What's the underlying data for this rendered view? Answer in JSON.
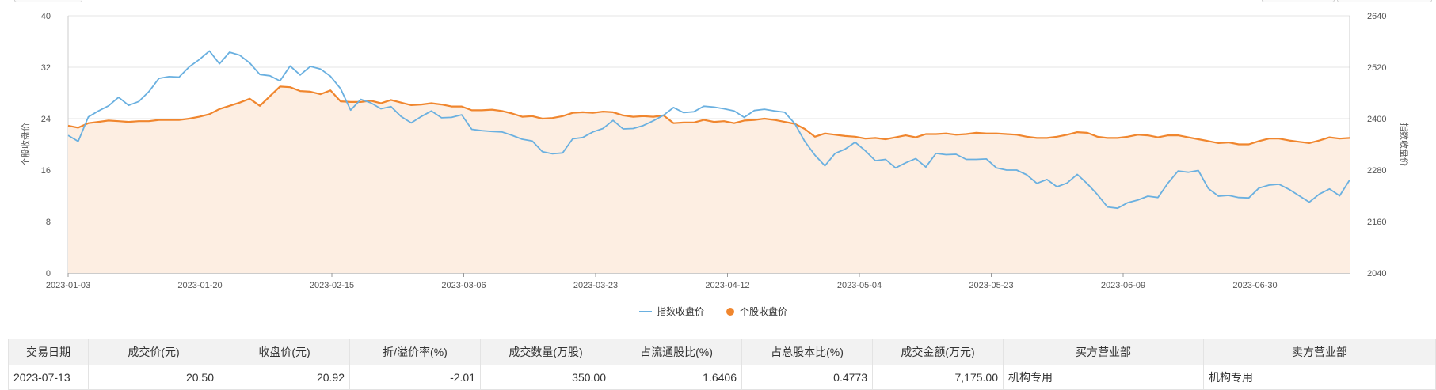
{
  "chart_data": {
    "type": "line",
    "x_ticks": [
      "2023-01-03",
      "2023-01-20",
      "2023-02-15",
      "2023-03-06",
      "2023-03-23",
      "2023-04-12",
      "2023-05-04",
      "2023-05-23",
      "2023-06-09",
      "2023-06-30"
    ],
    "left_axis": {
      "label": "个股收盘价",
      "ticks": [
        0,
        8,
        16,
        24,
        32,
        40
      ],
      "range": [
        0,
        40
      ]
    },
    "right_axis": {
      "label": "指数收盘价",
      "ticks": [
        2040,
        2160,
        2280,
        2400,
        2520,
        2640
      ],
      "range": [
        2040,
        2640
      ]
    },
    "legend": [
      "指数收盘价",
      "个股收盘价"
    ],
    "series": [
      {
        "name": "指数收盘价",
        "axis": "right",
        "color": "#6ab0e0",
        "values": [
          2361,
          2347,
          2404,
          2418,
          2430,
          2450,
          2431,
          2440,
          2463,
          2494,
          2498,
          2497,
          2521,
          2538,
          2558,
          2528,
          2555,
          2548,
          2530,
          2503,
          2500,
          2488,
          2523,
          2502,
          2522,
          2516,
          2499,
          2470,
          2420,
          2445,
          2437,
          2423,
          2428,
          2405,
          2390,
          2405,
          2418,
          2402,
          2403,
          2409,
          2375,
          2372,
          2370,
          2369,
          2361,
          2352,
          2348,
          2323,
          2318,
          2320,
          2353,
          2356,
          2369,
          2377,
          2396,
          2376,
          2377,
          2384,
          2395,
          2408,
          2426,
          2414,
          2416,
          2429,
          2427,
          2423,
          2418,
          2403,
          2419,
          2422,
          2418,
          2415,
          2389,
          2347,
          2315,
          2290,
          2319,
          2329,
          2345,
          2325,
          2302,
          2305,
          2285,
          2297,
          2307,
          2287,
          2319,
          2316,
          2317,
          2305,
          2305,
          2306,
          2285,
          2280,
          2280,
          2269,
          2249,
          2258,
          2241,
          2250,
          2270,
          2248,
          2223,
          2194,
          2191,
          2204,
          2210,
          2219,
          2216,
          2250,
          2278,
          2275,
          2279,
          2237,
          2219,
          2221,
          2216,
          2215,
          2238,
          2245,
          2247,
          2235,
          2220,
          2205,
          2224,
          2236,
          2220,
          2257
        ]
      },
      {
        "name": "个股收盘价",
        "axis": "left",
        "color": "#f0862e",
        "values": [
          22.9,
          22.6,
          23.3,
          23.5,
          23.7,
          23.6,
          23.5,
          23.6,
          23.6,
          23.8,
          23.8,
          23.8,
          24.0,
          24.3,
          24.7,
          25.5,
          26.0,
          26.5,
          27.1,
          26.0,
          27.5,
          29.0,
          28.9,
          28.3,
          28.2,
          27.8,
          28.4,
          26.7,
          26.6,
          26.6,
          26.8,
          26.4,
          26.9,
          26.5,
          26.1,
          26.2,
          26.4,
          26.2,
          25.9,
          25.9,
          25.3,
          25.3,
          25.4,
          25.2,
          24.8,
          24.3,
          24.4,
          24.0,
          24.1,
          24.4,
          24.9,
          25.0,
          24.9,
          25.1,
          25.0,
          24.5,
          24.3,
          24.4,
          24.3,
          24.5,
          23.3,
          23.4,
          23.4,
          23.8,
          23.5,
          23.6,
          23.3,
          23.7,
          23.8,
          24.0,
          23.8,
          23.5,
          23.2,
          22.4,
          21.2,
          21.7,
          21.5,
          21.3,
          21.2,
          20.9,
          21.0,
          20.8,
          21.1,
          21.4,
          21.1,
          21.6,
          21.6,
          21.7,
          21.5,
          21.6,
          21.8,
          21.7,
          21.7,
          21.6,
          21.5,
          21.2,
          21.0,
          21.0,
          21.2,
          21.5,
          21.9,
          21.8,
          21.2,
          21.0,
          21.0,
          21.2,
          21.5,
          21.4,
          21.1,
          21.4,
          21.4,
          21.1,
          20.8,
          20.5,
          20.2,
          20.3,
          20.0,
          20.0,
          20.5,
          20.9,
          20.9,
          20.6,
          20.4,
          20.2,
          20.6,
          21.1,
          20.9,
          21.0
        ]
      }
    ]
  },
  "table": {
    "headers": [
      "交易日期",
      "成交价(元)",
      "收盘价(元)",
      "折/溢价率(%)",
      "成交数量(万股)",
      "占流通股比(%)",
      "占总股本比(%)",
      "成交金额(万元)",
      "买方营业部",
      "卖方营业部"
    ],
    "row": [
      "2023-07-13",
      "20.50",
      "20.92",
      "-2.01",
      "350.00",
      "1.6406",
      "0.4773",
      "7,175.00",
      "机构专用",
      "机构专用"
    ]
  }
}
